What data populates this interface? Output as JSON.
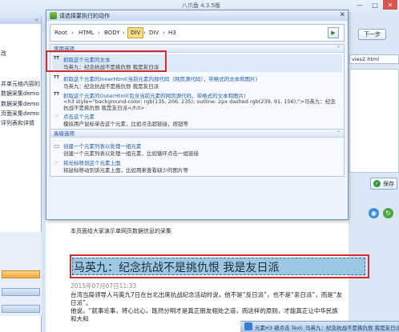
{
  "app": {
    "title": "八爪鱼 4.3.5版",
    "window_controls": [
      "—",
      "□",
      "✕"
    ]
  },
  "left_panel": {
    "collapse_glyph": "«",
    "items": [
      "改",
      "并单元格内容的",
      "数据采集demo",
      "数据采集demo",
      "页面采集demo",
      "评列表和详情"
    ]
  },
  "right_panel": {
    "next_label": "下一步",
    "filename": "vies2.html",
    "save_label": "保存"
  },
  "dialog": {
    "title": "请选择要执行的动作",
    "close_glyph": "✕",
    "breadcrumb": [
      "Root",
      "HTML",
      "BODY",
      "DIV",
      "DIV",
      "H3"
    ],
    "breadcrumb_selected_index": 3,
    "common_section": {
      "title": "常用选项",
      "options": [
        {
          "icon": "TT",
          "title": "抓取这个元素的文本",
          "desc": "马英九：纪念抗战不是挑仇恨 我是友日派"
        },
        {
          "icon": "TT",
          "title": "抓取这个元素的InnerHtml(当前元素内部代码（网页源代码），带格式的文本和图片)",
          "desc": "马英九：纪念抗战不是挑仇恨 我是友日派"
        },
        {
          "icon": "TT",
          "title": "抓取这个元素的OuterHtml(包含当前元素的网页源代码，带格式的文本和图片)",
          "desc": "<h3 style=\"background-color: rgb(135, 206, 235); outline: 2px dashed rgb(239, 91, 156);\">马英九：纪念抗战不是挑仇恨 我是友日派</h3>"
        },
        {
          "icon": "☞",
          "title": "点击这个元素",
          "desc": "模拟用户鼠标单击这个元素，比如点击超链接，按钮等"
        }
      ]
    },
    "advanced_section": {
      "title": "高级选项",
      "options": [
        {
          "icon": "▭",
          "title": "创建一个元素列表以处理一组元素",
          "desc": "创建一个元素列表以处理一组元素，比如循环点击一组链接"
        },
        {
          "icon": "☞",
          "title": "将光标移到这个元素上面",
          "desc": "将鼠标移动到该元素上面，比如用来查看缺少的图片等"
        }
      ]
    }
  },
  "preview": {
    "header": "本页面给大家演示单网页数据信息的采集",
    "title": "马英九：纪念抗战不是挑仇恨 我是友日派",
    "date": "2015年07月07日11:33",
    "body_lines": [
      "台湾当局领导人马英九7日在台北出席抗战纪念活动时说，他不是“反日派”，也不是“亲日派”，而是“友日派”。",
      "他说，“就事论事，将心比心，既然分明才是真正朋友相处之道，而这样的原则，才能真正让中华民族和大和"
    ]
  },
  "status": {
    "text": "元素H3 被点击 Text: 马英九：纪念抗战不是挑仇恨 我是友日派"
  },
  "colors": {
    "selection_red": "#d62b2b",
    "breadcrumb_selected": "#f8dc82",
    "title_highlight": "#9cc8e3",
    "link_blue": "#1f5cb0"
  }
}
